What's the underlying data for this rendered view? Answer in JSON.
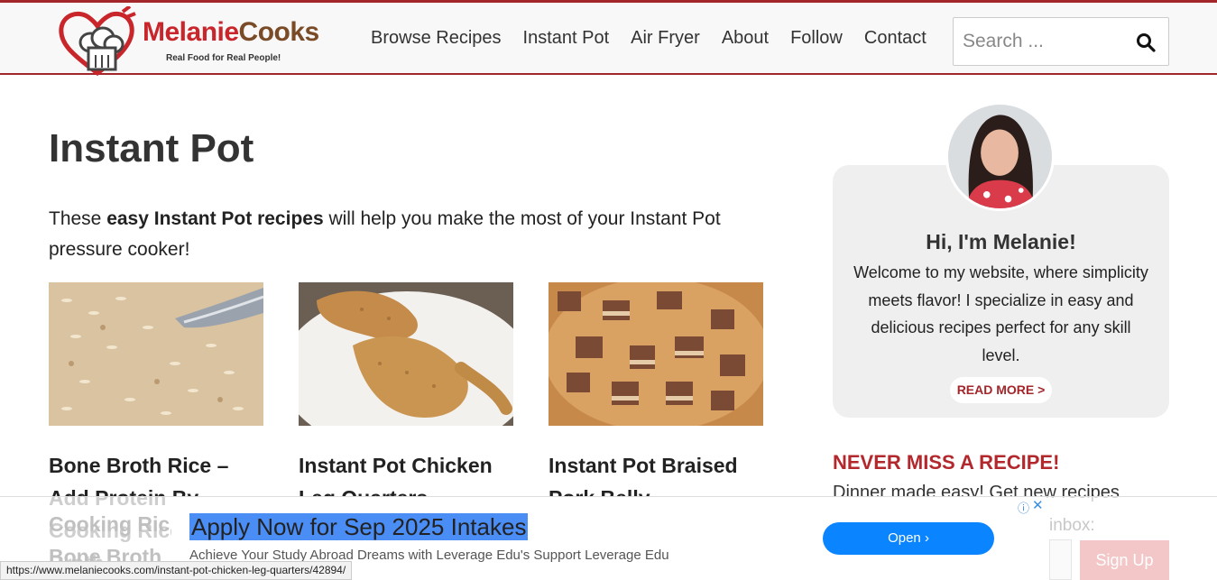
{
  "site": {
    "logo_name_part1": "Melanie",
    "logo_name_part2": "Cooks",
    "tagline": "Real Food for Real People!"
  },
  "nav": {
    "items": [
      "Browse Recipes",
      "Instant Pot",
      "Air Fryer",
      "About",
      "Follow",
      "Contact"
    ]
  },
  "search": {
    "placeholder": "Search ...",
    "icon": "search-icon"
  },
  "main": {
    "title": "Instant Pot",
    "intro_pre": "These ",
    "intro_bold": "easy Instant Pot recipes",
    "intro_post": " will help you make the most of your Instant Pot pressure cooker!",
    "cards": [
      {
        "title": "Bone Broth Rice – Add Protein By Cooking Rice in Bone Broth"
      },
      {
        "title": "Instant Pot Chicken Leg Quarters"
      },
      {
        "title": "Instant Pot Braised Pork Belly"
      }
    ]
  },
  "sidebar": {
    "greeting": "Hi, I'm Melanie!",
    "welcome": "Welcome to my website, where simplicity meets flavor! I specialize in easy and delicious recipes perfect for any skill level.",
    "read_more": "READ MORE >",
    "newsletter_title": "NEVER MISS A RECIPE!",
    "newsletter_text": "Dinner made easy! Get new recipes",
    "newsletter_text_2": "inbox:",
    "signup_label": "Sign Up"
  },
  "ad": {
    "title": "Apply Now for Sep 2025 Intakes",
    "subtitle": "Achieve Your Study Abroad Dreams with Leverage Edu's Support Leverage Edu",
    "cta": "Open",
    "info_icon": "ⓘ",
    "close_icon": "✕"
  },
  "status_url": "https://www.melaniecooks.com/instant-pot-chicken-leg-quarters/42894/",
  "colors": {
    "brand_red": "#a3262a",
    "brand_brown": "#7a4b27",
    "ad_button": "#0a84ff"
  }
}
